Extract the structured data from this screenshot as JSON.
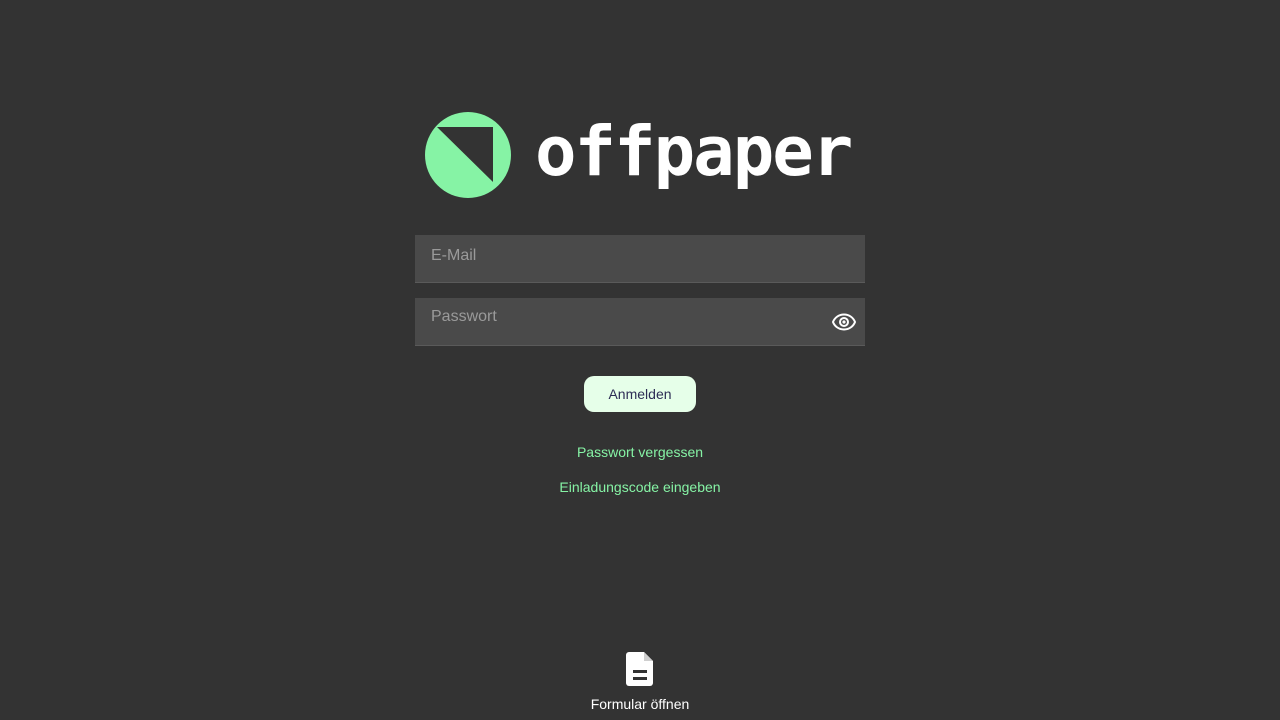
{
  "brand": {
    "name": "offpaper",
    "accent_color": "#86f3a5"
  },
  "login": {
    "email_placeholder": "E-Mail",
    "password_placeholder": "Passwort",
    "password_toggle_icon": "eye-icon",
    "submit_label": "Anmelden"
  },
  "links": {
    "forgot_password": "Passwort vergessen",
    "enter_invite_code": "Einladungscode eingeben"
  },
  "footer": {
    "open_form_icon": "document-icon",
    "open_form_label": "Formular öffnen"
  }
}
